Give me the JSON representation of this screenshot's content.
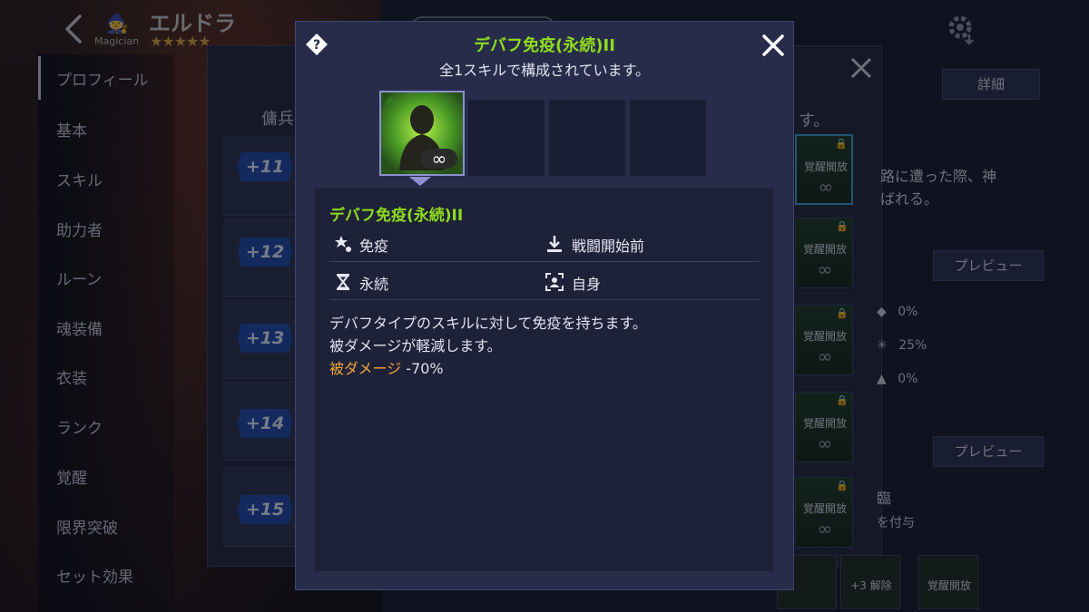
{
  "background": {
    "character": {
      "class_label": "Magician",
      "name": "エルドラ",
      "stars": "★★★★★"
    },
    "sidebar": {
      "items": [
        "プロフィール",
        "基本",
        "スキル",
        "助力者",
        "ルーン",
        "魂装備",
        "衣装",
        "ランク",
        "覚醒",
        "限界突破",
        "セット効果"
      ]
    },
    "panel": {
      "header_left": "傭兵",
      "header_right": "す。",
      "rows": [
        "+11",
        "+12",
        "+13",
        "+14",
        "+15"
      ],
      "awaken_label": "覚醒開放",
      "infinity": "∞",
      "tab_detail": "詳細",
      "preview_label": "プレビュー",
      "desc_line1": "路に遭った際、神",
      "desc_line2": "ばれる。",
      "stats": [
        {
          "icon": "◆",
          "value": "0%"
        },
        {
          "icon": "✳",
          "value": "25%"
        },
        {
          "icon": "▲",
          "value": "0%"
        }
      ],
      "partial_text1": "臨",
      "partial_text2": "を付与",
      "unlock_label": "+3 解除"
    }
  },
  "modal": {
    "help_symbol": "?",
    "title": "デバフ免疫(永続)II",
    "subtitle": "全1スキルで構成されています。",
    "skill": {
      "name": "デバフ免疫(永続)II",
      "attributes": [
        {
          "icon": "immunity-icon",
          "label": "免疫"
        },
        {
          "icon": "pre-battle-icon",
          "label": "戦闘開始前"
        },
        {
          "icon": "hourglass-icon",
          "label": "永続"
        },
        {
          "icon": "self-target-icon",
          "label": "自身"
        }
      ],
      "description": [
        "デバフタイプのスキルに対して免疫を持ちます。",
        "被ダメージが軽減します。"
      ],
      "effect_label": "被ダメージ",
      "effect_value": " -70%"
    }
  },
  "colors": {
    "accent_green": "#8fdc1e",
    "highlight_orange": "#f0a63c",
    "modal_bg": "#272c4a",
    "badge_blue": "#2048a8"
  }
}
